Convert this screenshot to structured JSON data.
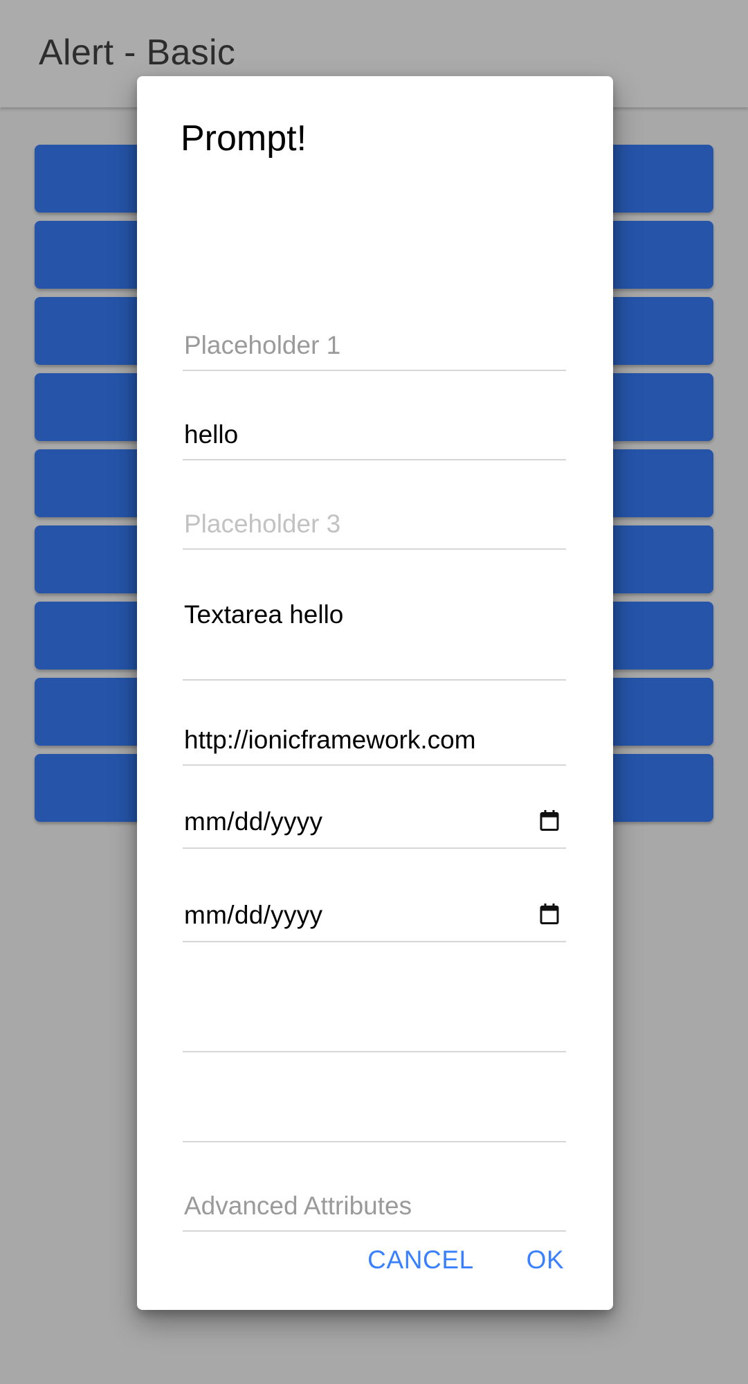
{
  "toolbar": {
    "title": "Alert - Basic"
  },
  "background_buttons": [
    {
      "label": ""
    },
    {
      "label": ""
    },
    {
      "label": ""
    },
    {
      "label": ""
    },
    {
      "label": ""
    },
    {
      "label": ""
    },
    {
      "label": ""
    },
    {
      "label": ""
    },
    {
      "label": ""
    }
  ],
  "dialog": {
    "title": "Prompt!",
    "inputs": {
      "name1": {
        "value": "",
        "placeholder": "Placeholder 1"
      },
      "name2": {
        "value": "hello",
        "placeholder": ""
      },
      "name3": {
        "value": "",
        "placeholder": "Placeholder 3"
      },
      "textarea": {
        "value": "Textarea hello",
        "placeholder": ""
      },
      "url": {
        "value": "http://ionicframework.com",
        "placeholder": ""
      },
      "date1": {
        "display": "mm/dd/yyyy"
      },
      "date2": {
        "display": "mm/dd/yyyy"
      },
      "number1": {
        "value": "",
        "placeholder": ""
      },
      "number2": {
        "value": "",
        "placeholder": ""
      },
      "advanced": {
        "value": "",
        "placeholder": "Advanced Attributes"
      }
    },
    "buttons": {
      "cancel": "CANCEL",
      "ok": "OK"
    }
  },
  "colors": {
    "primary_button": "#2554a9",
    "action_text": "#3880ff",
    "backdrop": "#a8a8a8"
  }
}
